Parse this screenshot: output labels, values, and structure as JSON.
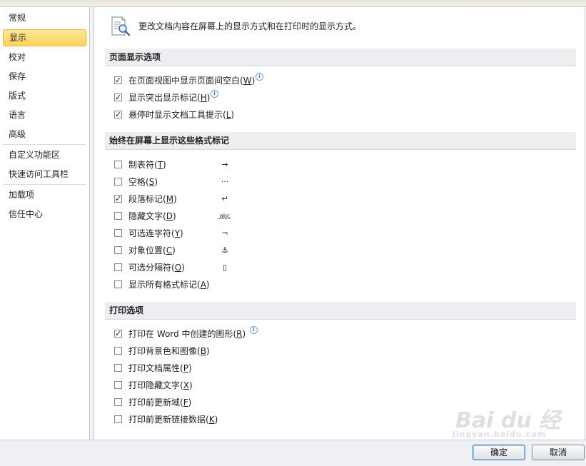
{
  "sidebar": {
    "items": [
      {
        "label": "常规",
        "selected": false
      },
      {
        "label": "显示",
        "selected": true
      },
      {
        "label": "校对",
        "selected": false
      },
      {
        "label": "保存",
        "selected": false
      },
      {
        "label": "版式",
        "selected": false
      },
      {
        "label": "语言",
        "selected": false
      },
      {
        "label": "高级",
        "selected": false
      },
      {
        "label": "自定义功能区",
        "selected": false
      },
      {
        "label": "快速访问工具栏",
        "selected": false
      },
      {
        "label": "加载项",
        "selected": false
      },
      {
        "label": "信任中心",
        "selected": false
      }
    ]
  },
  "header": {
    "description": "更改文档内容在屏幕上的显示方式和在打印时的显示方式。",
    "icon": "document-magnifier-icon"
  },
  "sections": {
    "page_display": {
      "title": "页面显示选项",
      "options": [
        {
          "label": "在页面视图中显示页面间空白",
          "key": "W",
          "checked": true,
          "info": true
        },
        {
          "label": "显示突出显示标记",
          "key": "H",
          "checked": true,
          "info": true
        },
        {
          "label": "悬停时显示文档工具提示",
          "key": "L",
          "checked": true,
          "info": false
        }
      ]
    },
    "format_marks": {
      "title": "始终在屏幕上显示这些格式标记",
      "options": [
        {
          "label": "制表符",
          "key": "T",
          "checked": false,
          "symbol": "→"
        },
        {
          "label": "空格",
          "key": "S",
          "checked": false,
          "symbol": "···"
        },
        {
          "label": "段落标记",
          "key": "M",
          "checked": true,
          "symbol": "↵"
        },
        {
          "label": "隐藏文字",
          "key": "D",
          "checked": false,
          "symbol": "abc"
        },
        {
          "label": "可选连字符",
          "key": "Y",
          "checked": false,
          "symbol": "¬"
        },
        {
          "label": "对象位置",
          "key": "C",
          "checked": false,
          "symbol": "⚓"
        },
        {
          "label": "可选分隔符",
          "key": "O",
          "checked": false,
          "symbol": "▯"
        },
        {
          "label": "显示所有格式标记",
          "key": "A",
          "checked": false,
          "symbol": ""
        }
      ]
    },
    "print": {
      "title": "打印选项",
      "options": [
        {
          "label": "打印在 Word 中创建的图形",
          "key": "R",
          "checked": true,
          "info": true
        },
        {
          "label": "打印背景色和图像",
          "key": "B",
          "checked": false,
          "info": false
        },
        {
          "label": "打印文档属性",
          "key": "P",
          "checked": false,
          "info": false
        },
        {
          "label": "打印隐藏文字",
          "key": "X",
          "checked": false,
          "info": false
        },
        {
          "label": "打印前更新域",
          "key": "F",
          "checked": false,
          "info": false
        },
        {
          "label": "打印前更新链接数据",
          "key": "K",
          "checked": false,
          "info": false
        }
      ]
    }
  },
  "footer": {
    "ok_label": "确定",
    "cancel_label": "取消"
  },
  "watermark": {
    "text": "Bai du 经验",
    "sub": "jingyan.baidu.com"
  },
  "colors": {
    "selected_nav": "#ffd35a",
    "section_bg": "#edeef0",
    "info_icon": "#2f6fbe"
  }
}
